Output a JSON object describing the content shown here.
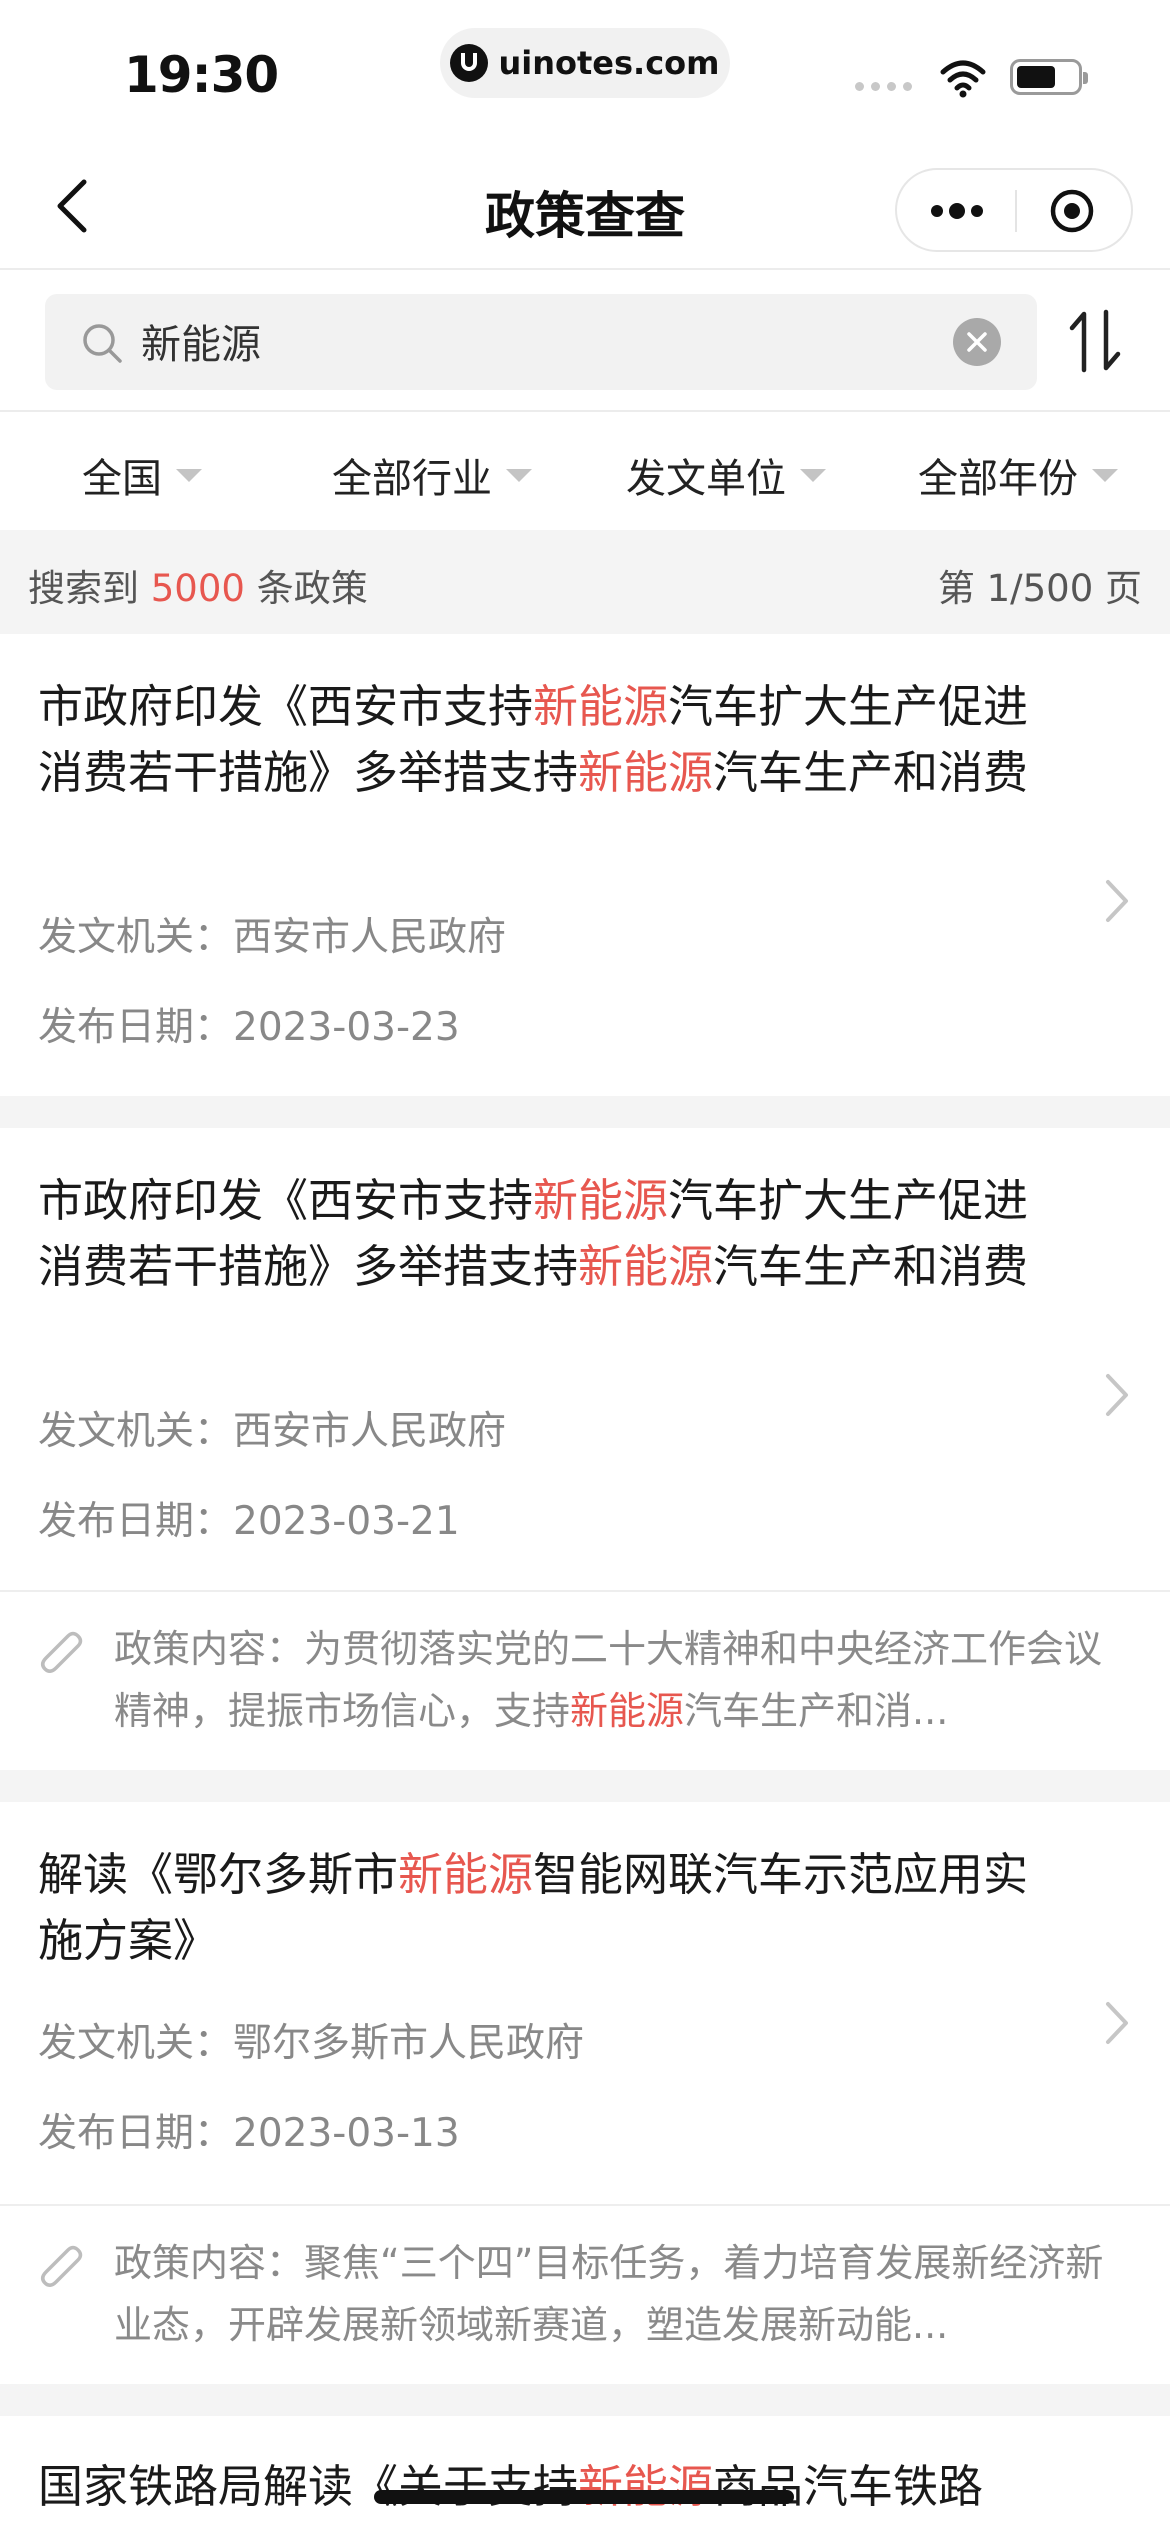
{
  "status": {
    "time": "19:30",
    "url": "uinotes.com"
  },
  "nav": {
    "title": "政策查查"
  },
  "search": {
    "value": "新能源"
  },
  "filters": [
    {
      "label": "全国"
    },
    {
      "label": "全部行业"
    },
    {
      "label": "发文单位"
    },
    {
      "label": "全部年份"
    }
  ],
  "summary": {
    "prefix": "搜索到",
    "count": "5000",
    "suffix": "条政策",
    "page": "第 1/500 页"
  },
  "labels": {
    "issuer": "发文机关：",
    "date": "发布日期：",
    "content": "政策内容："
  },
  "policies": [
    {
      "title_parts": [
        "市政府印发《西安市支持",
        "新能源",
        "汽车扩大生产促进消费若干措施》多举措支持",
        "新能源",
        "汽车生产和消费"
      ],
      "issuer": "西安市人民政府",
      "date": "2023-03-23"
    },
    {
      "title_parts": [
        "市政府印发《西安市支持",
        "新能源",
        "汽车扩大生产促进消费若干措施》多举措支持",
        "新能源",
        "汽车生产和消费"
      ],
      "issuer": "西安市人民政府",
      "date": "2023-03-21",
      "excerpt_parts": [
        "为贯彻落实党的二十大精神和中央经济工作会议精神，提振市场信心，支持",
        "新能源",
        "汽车生产和消..."
      ]
    },
    {
      "title_parts": [
        "解读《鄂尔多斯市",
        "新能源",
        "智能网联汽车示范应用实施方案》"
      ],
      "issuer": "鄂尔多斯市人民政府",
      "date": "2023-03-13",
      "excerpt_parts": [
        "聚焦“三个四”目标任务，着力培育发展新经济新业态，开辟发展新领域新赛道，塑造发展新动能..."
      ]
    },
    {
      "title_parts": [
        "国家铁路局解读《关于支持",
        "新能源",
        "商品汽车铁路"
      ]
    }
  ],
  "colors": {
    "highlight": "#e7574f",
    "muted": "#888888",
    "background": "#f4f4f4"
  }
}
